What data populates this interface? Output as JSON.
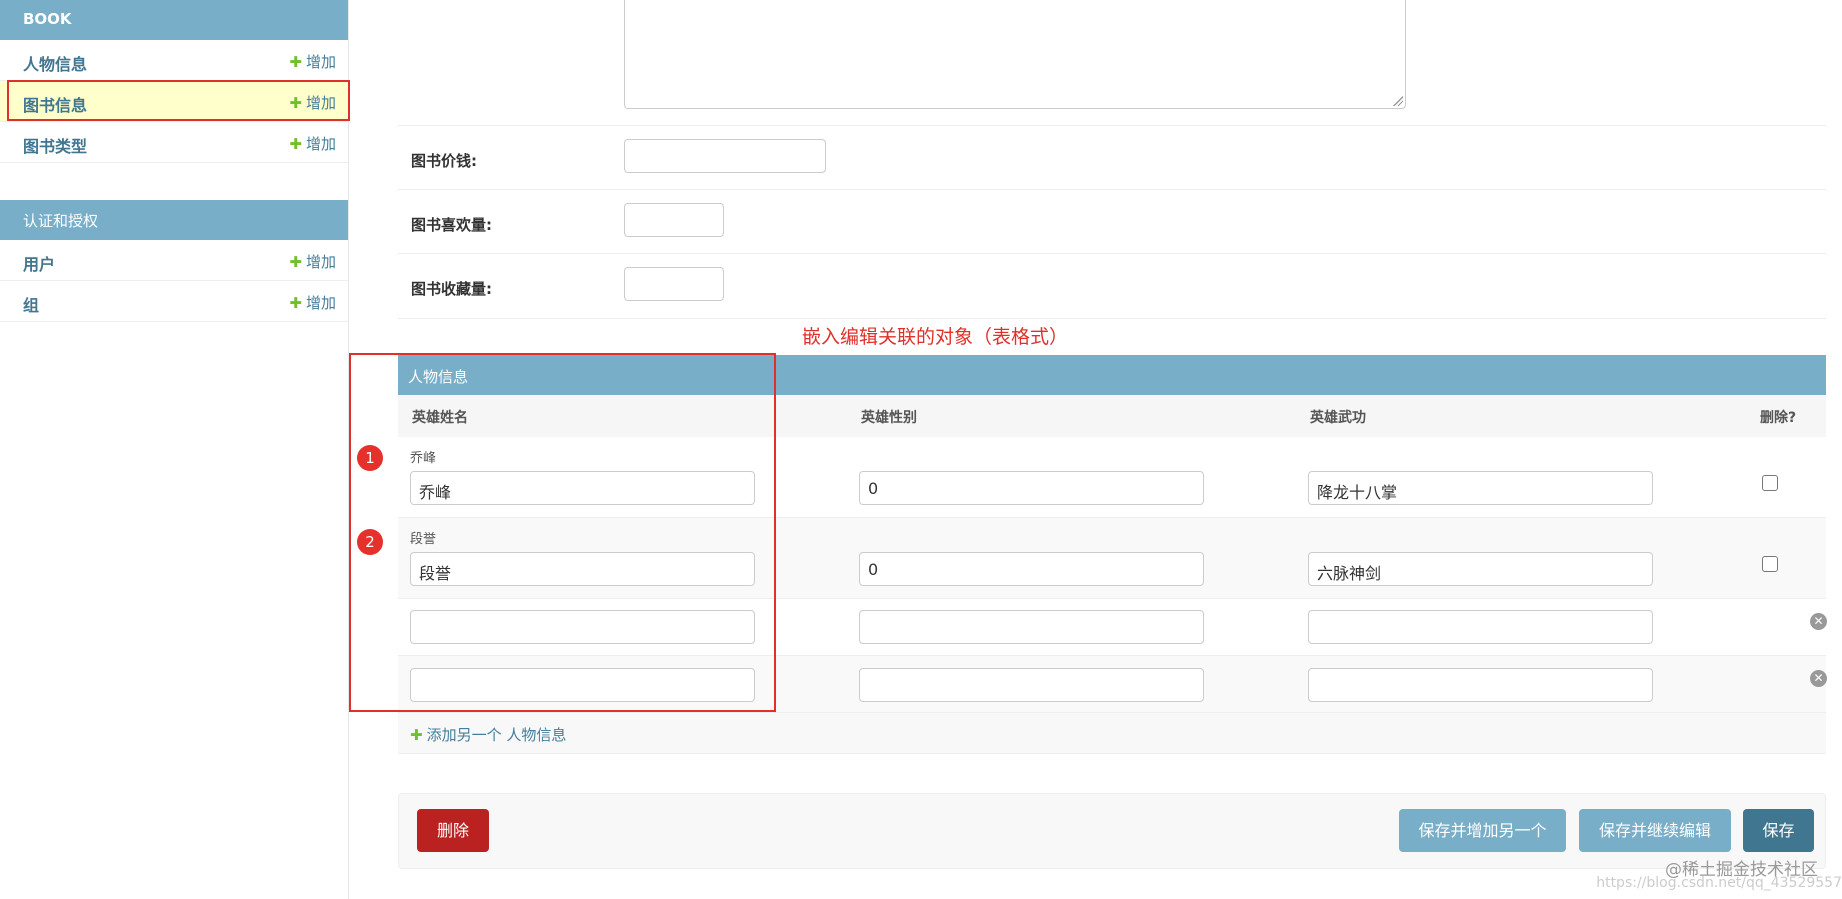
{
  "sidebar": {
    "app_book": "BOOK",
    "book_models": [
      {
        "name": "人物信息",
        "add": "增加"
      },
      {
        "name": "图书信息",
        "add": "增加"
      },
      {
        "name": "图书类型",
        "add": "增加"
      }
    ],
    "app_auth": "认证和授权",
    "auth_models": [
      {
        "name": "用户",
        "add": "增加"
      },
      {
        "name": "组",
        "add": "增加"
      }
    ]
  },
  "form": {
    "price_label": "图书价钱:",
    "likes_label": "图书喜欢量:",
    "favorites_label": "图书收藏量:"
  },
  "annotation": {
    "text": "嵌入编辑关联的对象（表格式）",
    "badge1": "1",
    "badge2": "2"
  },
  "inline": {
    "caption": "人物信息",
    "headers": [
      "英雄姓名",
      "英雄性别",
      "英雄武功",
      "删除?"
    ],
    "rows": [
      {
        "original": "乔峰",
        "name": "乔峰",
        "gender": "0",
        "skill": "降龙十八掌"
      },
      {
        "original": "段誉",
        "name": "段誉",
        "gender": "0",
        "skill": "六脉神剑"
      }
    ],
    "add_another": "添加另一个 人物信息"
  },
  "submit": {
    "delete": "删除",
    "save_add": "保存并增加另一个",
    "save_continue": "保存并继续编辑",
    "save": "保存"
  },
  "watermark": {
    "line1": "@稀土掘金技术社区",
    "line2": "https://blog.csdn.net/qq_43529557"
  },
  "colors": {
    "caption_bg": "#79aec8",
    "link": "#417690",
    "add_plus": "#70bf2b",
    "delete_button": "#ba2121",
    "save_button": "#417690",
    "annotation_red": "#e0302b",
    "selected_row": "#ffffcc"
  },
  "icons": {
    "add": "plus-icon",
    "remove_row": "close-circle-icon"
  }
}
